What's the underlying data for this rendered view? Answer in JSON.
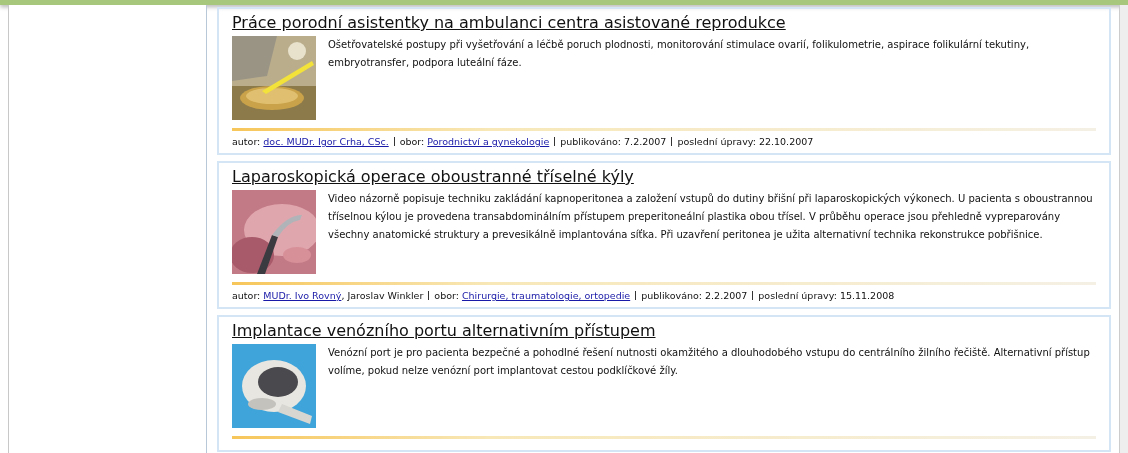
{
  "articles": [
    {
      "title": "Práce porodní asistentky na ambulanci centra asistované reprodukce",
      "text": "Ošetřovatelské postupy při vyšetřování a léčbě poruch plodnosti, monitorování stimulace ovarií, folikulometrie, aspirace folikulární tekutiny, embryotransfer, podpora luteální fáze.",
      "meta": [
        {
          "label": "autor:",
          "links": [
            "doc. MUDr. Igor Crha, CSc."
          ]
        },
        {
          "label": "obor:",
          "links": [
            "Porodnictví a gynekologie"
          ]
        },
        {
          "label": "publikováno:",
          "plain": "7.2.2007"
        },
        {
          "label": "poslední úpravy:",
          "plain": "22.10.2007"
        }
      ]
    },
    {
      "title": "Laparoskopická operace oboustranné tříselné kýly",
      "text": "Video názorně popisuje techniku zakládání kapnoperitonea a založení vstupů do dutiny břišní při laparoskopických výkonech. U pacienta s oboustrannou tříselnou kýlou je provedena transabdominálním přístupem preperitoneální plastika obou třísel. V průběhu operace jsou přehledně vypreparovány všechny anatomické struktury a prevesikálně implantována síťka. Při uzavření peritonea je užita alternativní technika rekonstrukce pobřišnice.",
      "meta": [
        {
          "label": "autor:",
          "links": [
            "MUDr. Ivo Rovný"
          ],
          "plain": ", Jaroslav Winkler"
        },
        {
          "label": "obor:",
          "links": [
            "Chirurgie, traumatologie, ortopedie"
          ]
        },
        {
          "label": "publikováno:",
          "plain": "2.2.2007"
        },
        {
          "label": "poslední úpravy:",
          "plain": "15.11.2008"
        }
      ]
    },
    {
      "title": "Implantace venózního portu alternativním přístupem",
      "text": "Venózní port je pro pacienta bezpečné a pohodlné řešení nutnosti okamžitého a dlouhodobého vstupu do centrálního žilního řečiště. Alternativní přístup volíme, pokud nelze venózní port implantovat cestou podklíčkové žíly."
    }
  ]
}
